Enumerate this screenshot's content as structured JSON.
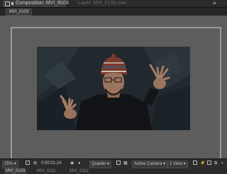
{
  "tabs": {
    "active_label": "Composition: MVI_0103",
    "close_glyph": "×",
    "inactive_label": "Layer: MVI_0103.mov",
    "menu_glyph": "≡"
  },
  "breadcrumb": {
    "label": "MVI_0103"
  },
  "viewer_toolbar": {
    "magnification": "25%",
    "timecode": "0:00:01:24",
    "resolution": "Quarter",
    "camera": "Active Camera",
    "views": "1 View"
  },
  "bottom_tabs": [
    "MVI_0103",
    "MVI_0111",
    "MVI_0112"
  ],
  "colors": {
    "pasteboard": "#5d5d5d",
    "comp_border": "#9a9a9a",
    "panel_bg": "#2b2b2b"
  }
}
